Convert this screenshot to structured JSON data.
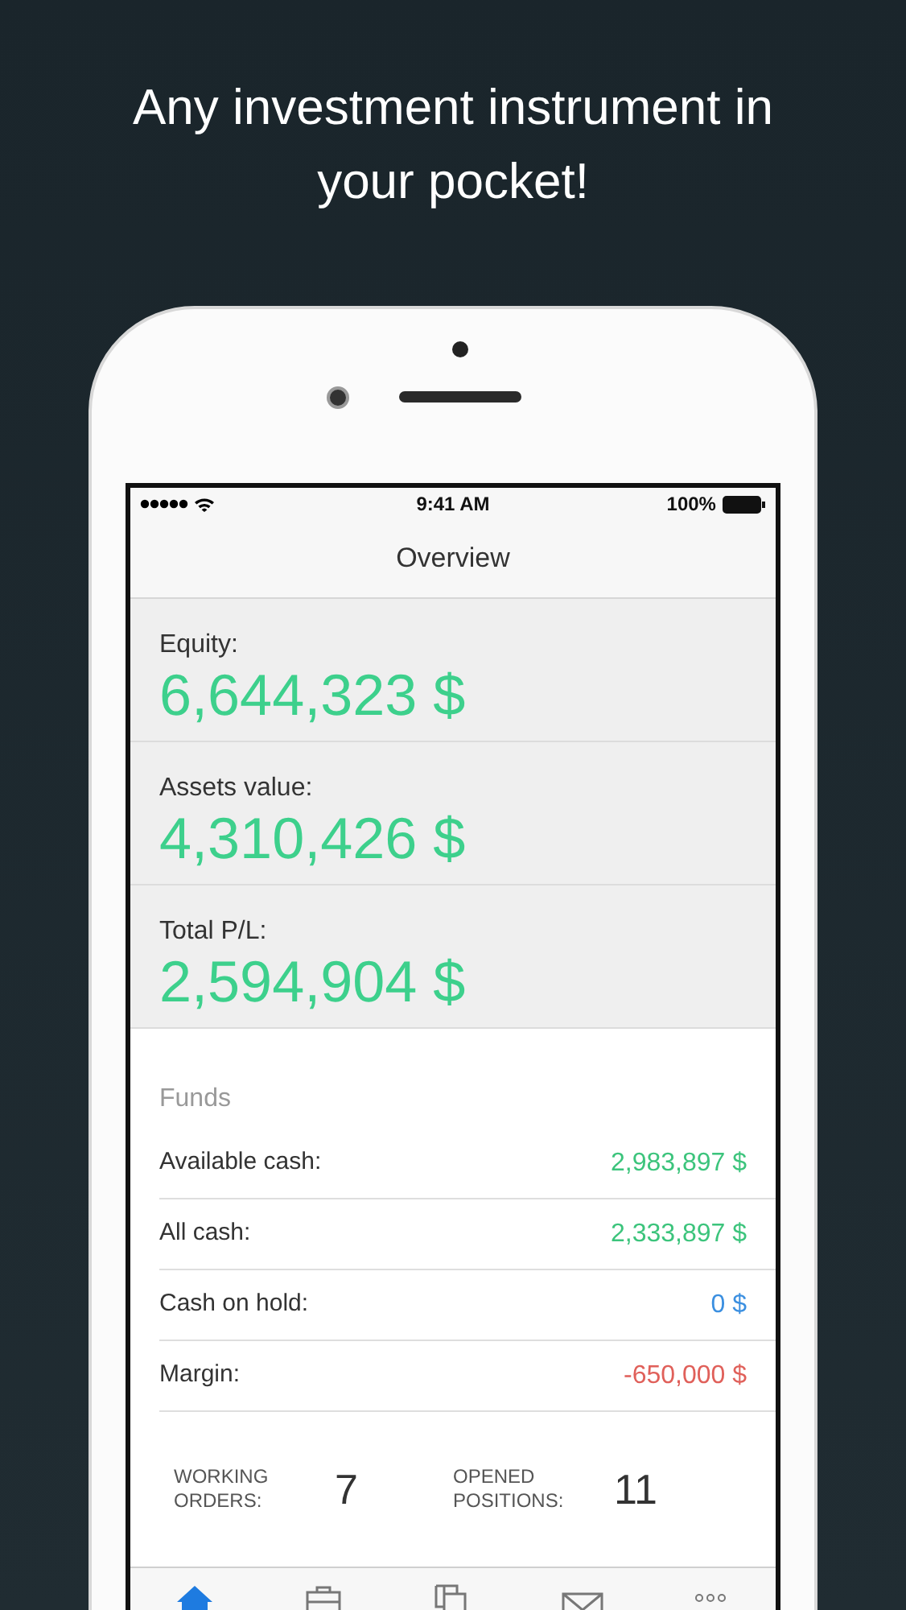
{
  "headline": "Any investment instrument in your pocket!",
  "status_bar": {
    "time": "9:41 AM",
    "battery": "100%"
  },
  "nav": {
    "title": "Overview"
  },
  "stats": [
    {
      "label": "Equity:",
      "value": "6,644,323 $"
    },
    {
      "label": "Assets value:",
      "value": "4,310,426 $"
    },
    {
      "label": "Total P/L:",
      "value": "2,594,904 $"
    }
  ],
  "funds": {
    "title": "Funds",
    "rows": [
      {
        "label": "Available cash:",
        "value": "2,983,897 $",
        "color": "#3cc47c"
      },
      {
        "label": "All cash:",
        "value": "2,333,897 $",
        "color": "#3cc47c"
      },
      {
        "label": "Cash on hold:",
        "value": "0 $",
        "color": "#3b8fe0"
      },
      {
        "label": "Margin:",
        "value": "-650,000 $",
        "color": "#e0605a"
      }
    ]
  },
  "summary": [
    {
      "label": "WORKING ORDERS:",
      "value": "7"
    },
    {
      "label": "OPENED POSITIONS:",
      "value": "11"
    }
  ],
  "tabs": [
    {
      "kind": "home",
      "selected": true
    },
    {
      "kind": "briefcase",
      "selected": false
    },
    {
      "kind": "windows",
      "selected": false
    },
    {
      "kind": "mail",
      "selected": false
    },
    {
      "kind": "more",
      "selected": false
    }
  ]
}
